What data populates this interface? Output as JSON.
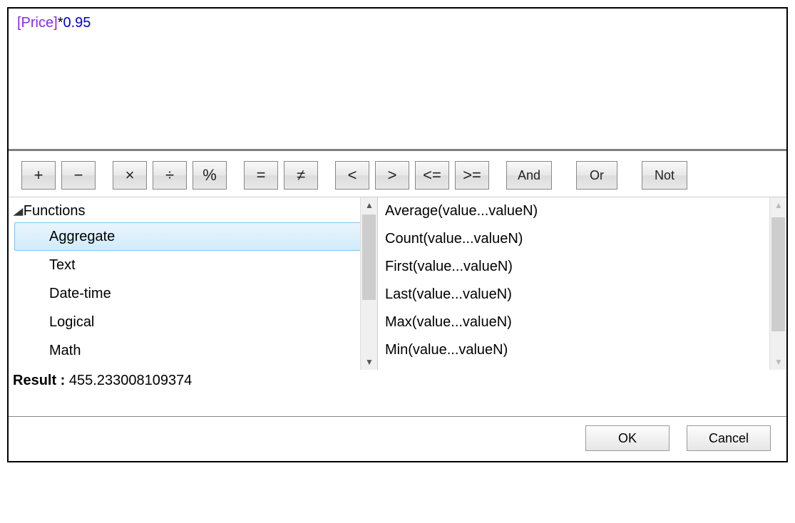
{
  "expression": {
    "field": "[Price]",
    "operator": "*",
    "number": "0.95"
  },
  "operators": {
    "plus": "+",
    "minus": "−",
    "multiply": "×",
    "divide": "÷",
    "modulo": "%",
    "equals": "=",
    "notequals": "≠",
    "lt": "<",
    "gt": ">",
    "lte": "<=",
    "gte": ">=",
    "and": "And",
    "or": "Or",
    "not": "Not"
  },
  "tree": {
    "root": "Functions",
    "items": [
      {
        "label": "Aggregate",
        "selected": true
      },
      {
        "label": "Text",
        "selected": false
      },
      {
        "label": "Date-time",
        "selected": false
      },
      {
        "label": "Logical",
        "selected": false
      },
      {
        "label": "Math",
        "selected": false
      }
    ]
  },
  "functions": [
    "Average(value...valueN)",
    "Count(value...valueN)",
    "First(value...valueN)",
    "Last(value...valueN)",
    "Max(value...valueN)",
    "Min(value...valueN)"
  ],
  "result": {
    "label": "Result : ",
    "value": "455.233008109374"
  },
  "buttons": {
    "ok": "OK",
    "cancel": "Cancel"
  }
}
